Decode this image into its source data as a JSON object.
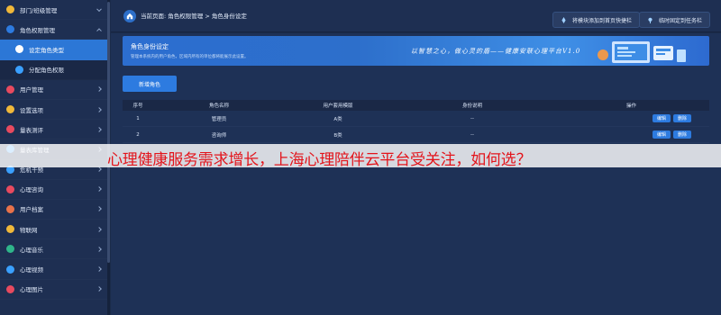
{
  "sidebar": {
    "items": [
      {
        "label": "部门/班级管理",
        "icon": "org-icon",
        "color": "#f0b83a",
        "arrow": "down"
      },
      {
        "label": "角色权限管理",
        "icon": "role-icon",
        "color": "#2d7be0",
        "arrow": "up"
      },
      {
        "label": "设定角色类型",
        "icon": "user-setting-icon",
        "color": "#ffffff"
      },
      {
        "label": "分配角色权限",
        "icon": "puzzle-icon",
        "color": "#3aa0ff"
      },
      {
        "label": "用户管理",
        "icon": "user-icon",
        "color": "#e84a5f",
        "arrow": "right"
      },
      {
        "label": "设置选项",
        "icon": "settings-icon",
        "color": "#f0b83a",
        "arrow": "right"
      },
      {
        "label": "量表测评",
        "icon": "heart-icon",
        "color": "#e84a5f",
        "arrow": "right"
      },
      {
        "label": "量表库管理",
        "icon": "library-icon",
        "color": "#3aa0ff",
        "arrow": "right"
      },
      {
        "label": "危机干预",
        "icon": "alert-icon",
        "color": "#3aa0ff",
        "arrow": "right"
      },
      {
        "label": "心理咨询",
        "icon": "consult-icon",
        "color": "#e84a5f",
        "arrow": "right"
      },
      {
        "label": "用户档案",
        "icon": "profile-icon",
        "color": "#e8724a",
        "arrow": "right"
      },
      {
        "label": "物联网",
        "icon": "iot-icon",
        "color": "#f0b83a",
        "arrow": "right"
      },
      {
        "label": "心理音乐",
        "icon": "music-icon",
        "color": "#2fb58a",
        "arrow": "right"
      },
      {
        "label": "心理视频",
        "icon": "video-icon",
        "color": "#3aa0ff",
        "arrow": "right"
      },
      {
        "label": "心理图片",
        "icon": "picture-icon",
        "color": "#e84a5f",
        "arrow": "right"
      }
    ]
  },
  "header": {
    "breadcrumb": "当前页面: 角色权限管理 > 角色身份设定",
    "btn_quick": "将模块添加到首页快捷栏",
    "btn_pin": "临时固定到任务栏"
  },
  "banner": {
    "title": "角色身份设定",
    "subtitle": "管理本系统内的用户角色，区域内所有的单位都将能展示此设置。",
    "slogan": "以智慧之心，做心灵的盾——健康安联心理平台V1.0"
  },
  "toolbar": {
    "add_label": "新增角色"
  },
  "table": {
    "headers": [
      "序号",
      "角色名称",
      "用户套用模版",
      "身份说明",
      "操作"
    ],
    "rows": [
      {
        "no": "1",
        "name": "管理员",
        "template": "A类",
        "desc": "--",
        "edit": "编辑",
        "delete": "删除"
      },
      {
        "no": "2",
        "name": "咨询师",
        "template": "B类",
        "desc": "--",
        "edit": "编辑",
        "delete": "删除"
      }
    ]
  },
  "overlay": {
    "text": "心理健康服务需求增长，上海心理陪伴云平台受关注，如何选？"
  }
}
